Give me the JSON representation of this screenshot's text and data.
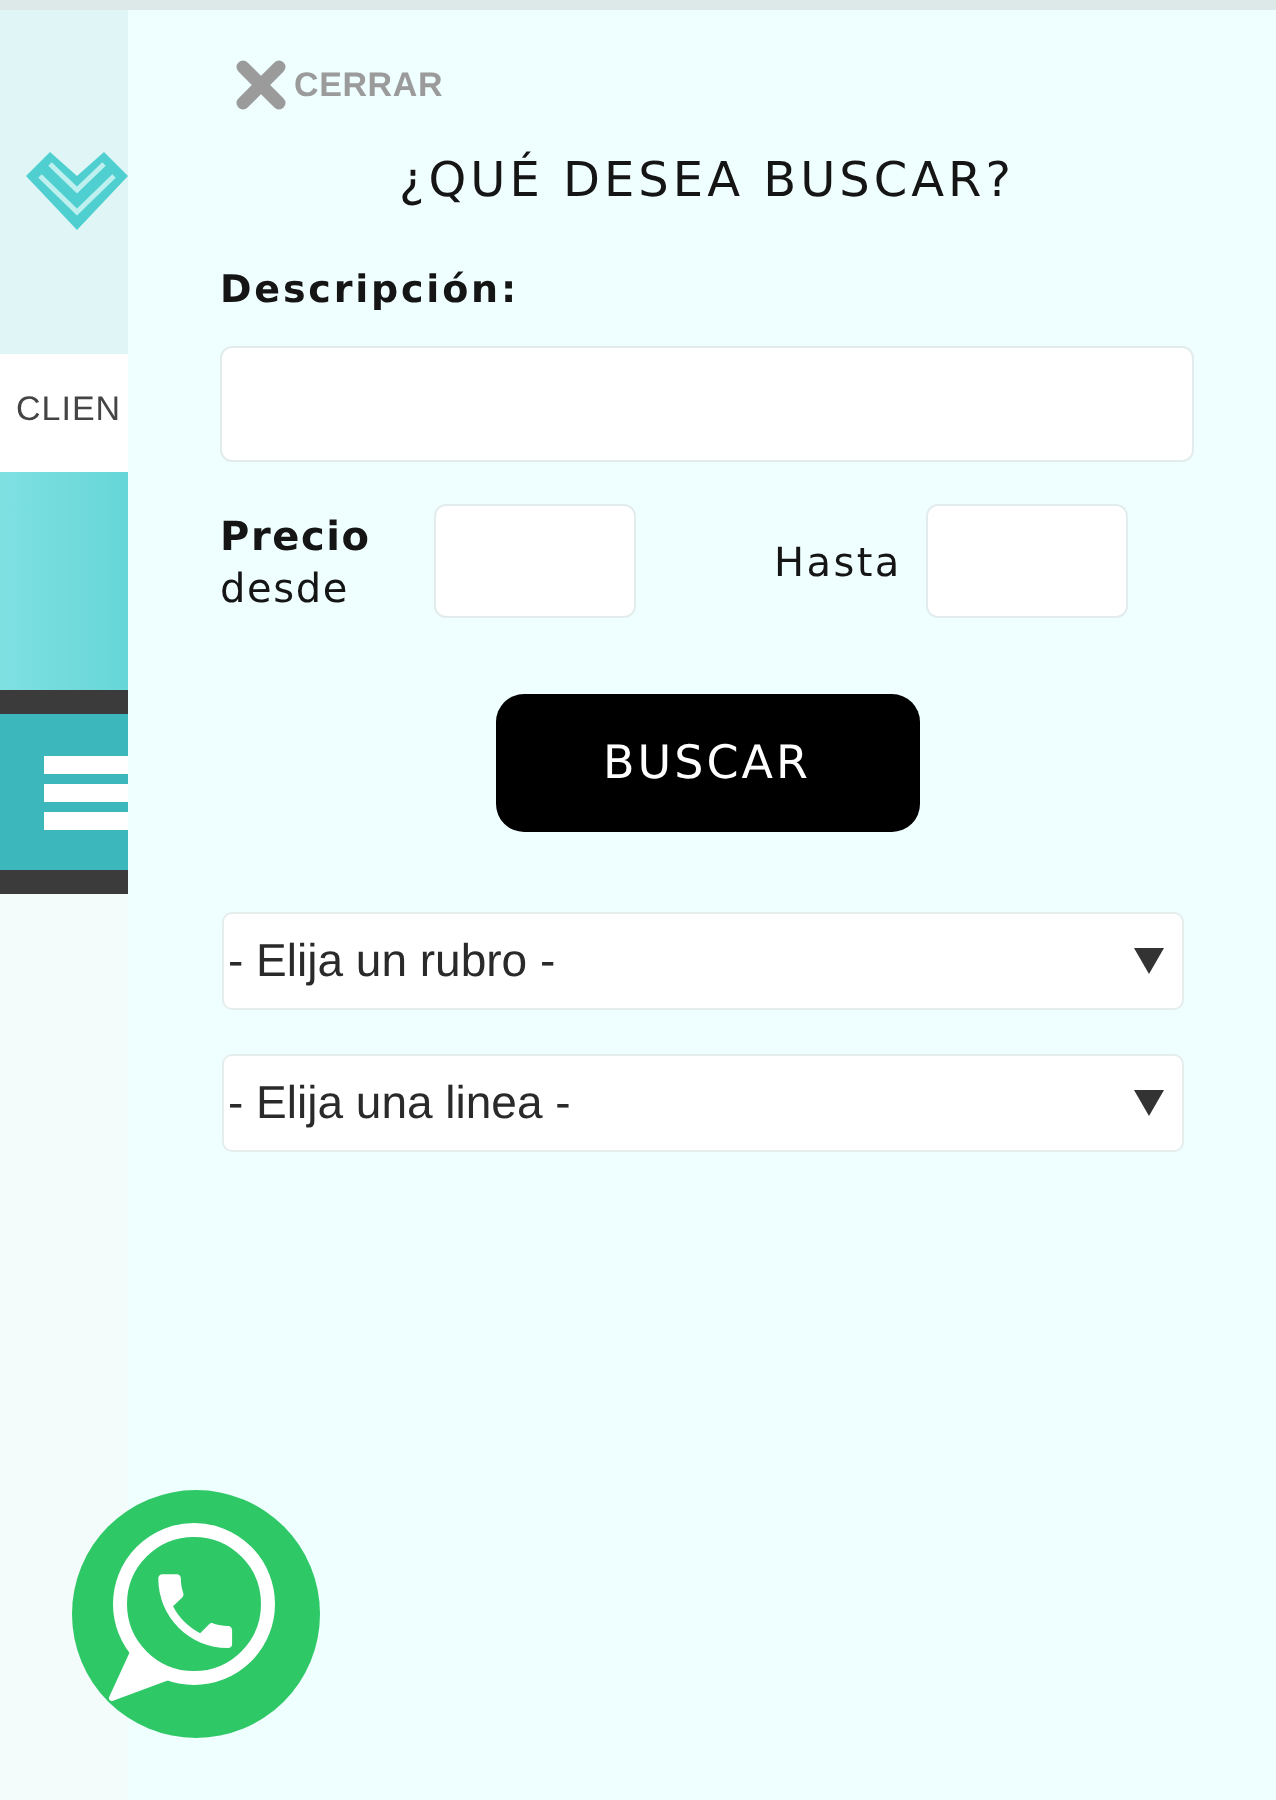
{
  "background_page": {
    "nav_label": "CLIEN"
  },
  "search_panel": {
    "close_label": "CERRAR",
    "title": "¿QUÉ DESEA BUSCAR?",
    "description": {
      "label": "Descripción:"
    },
    "price": {
      "from_label": "**Precio** desde",
      "to_label": "Hasta"
    },
    "search_button": "BUSCAR",
    "dropdowns": [
      {
        "value": "- Elija un rubro -"
      },
      {
        "value": "- Elija una linea -"
      }
    ]
  }
}
